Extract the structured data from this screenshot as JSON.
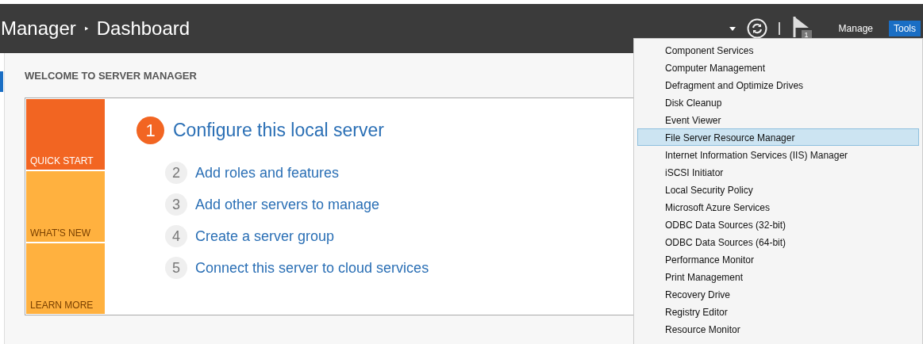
{
  "header": {
    "breadcrumb": [
      "Manager",
      "Dashboard"
    ],
    "separator": "‣",
    "notification_count": "1",
    "menus": [
      {
        "label": "Manage",
        "selected": false
      },
      {
        "label": "Tools",
        "selected": true
      }
    ]
  },
  "welcome": {
    "title": "WELCOME TO SERVER MANAGER",
    "tiles": [
      {
        "label": "QUICK START",
        "selected": true
      },
      {
        "label": "WHAT'S NEW",
        "selected": false
      },
      {
        "label": "LEARN MORE",
        "selected": false
      }
    ],
    "steps": [
      {
        "number": "1",
        "label": "Configure this local server",
        "kind": "primary"
      },
      {
        "number": "2",
        "label": "Add roles and features",
        "kind": "secondary"
      },
      {
        "number": "3",
        "label": "Add other servers to manage",
        "kind": "secondary"
      },
      {
        "number": "4",
        "label": "Create a server group",
        "kind": "secondary"
      },
      {
        "number": "5",
        "label": "Connect this server to cloud services",
        "kind": "secondary"
      }
    ]
  },
  "tools_menu": {
    "items": [
      {
        "label": "Component Services",
        "selected": false
      },
      {
        "label": "Computer Management",
        "selected": false
      },
      {
        "label": "Defragment and Optimize Drives",
        "selected": false
      },
      {
        "label": "Disk Cleanup",
        "selected": false
      },
      {
        "label": "Event Viewer",
        "selected": false
      },
      {
        "label": "File Server Resource Manager",
        "selected": true
      },
      {
        "label": "Internet Information Services (IIS) Manager",
        "selected": false
      },
      {
        "label": "iSCSI Initiator",
        "selected": false
      },
      {
        "label": "Local Security Policy",
        "selected": false
      },
      {
        "label": "Microsoft Azure Services",
        "selected": false
      },
      {
        "label": "ODBC Data Sources (32-bit)",
        "selected": false
      },
      {
        "label": "ODBC Data Sources (64-bit)",
        "selected": false
      },
      {
        "label": "Performance Monitor",
        "selected": false
      },
      {
        "label": "Print Management",
        "selected": false
      },
      {
        "label": "Recovery Drive",
        "selected": false
      },
      {
        "label": "Registry Editor",
        "selected": false
      },
      {
        "label": "Resource Monitor",
        "selected": false
      }
    ]
  }
}
